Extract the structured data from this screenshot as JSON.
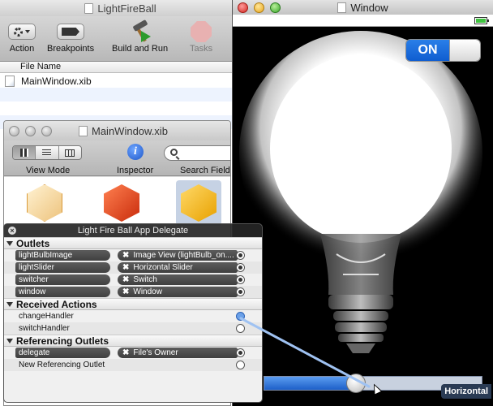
{
  "xcode": {
    "title": "LightFireBall",
    "toolbar": [
      {
        "label": "Action",
        "icon": "gear-icon"
      },
      {
        "label": "Breakpoints",
        "icon": "breakpoint-icon"
      },
      {
        "label": "Build and Run",
        "icon": "hammer-icon"
      },
      {
        "label": "Tasks",
        "icon": "stop-icon"
      }
    ],
    "file_column": "File Name",
    "files": [
      "MainWindow.xib"
    ]
  },
  "xib_window": {
    "title": "MainWindow.xib",
    "view_mode_label": "View Mode",
    "inspector_label": "Inspector",
    "search_label": "Search Field"
  },
  "hud": {
    "title": "Light Fire Ball App Delegate",
    "sections": {
      "outlets": "Outlets",
      "received_actions": "Received Actions",
      "referencing_outlets": "Referencing Outlets"
    },
    "outlets": [
      {
        "name": "lightBulbImage",
        "target": "Image View (lightBulb_on...."
      },
      {
        "name": "lightSlider",
        "target": "Horizontal Slider"
      },
      {
        "name": "switcher",
        "target": "Switch"
      },
      {
        "name": "window",
        "target": "Window"
      }
    ],
    "actions": [
      {
        "name": "changeHandler"
      },
      {
        "name": "switchHandler"
      }
    ],
    "referencing": [
      {
        "name": "delegate",
        "target": "File's Owner"
      },
      {
        "name": "New Referencing Outlet"
      }
    ]
  },
  "simulator": {
    "title": "Window",
    "switch_label": "ON",
    "slider_value": 0.42,
    "slider_label": "Horizontal"
  },
  "colors": {
    "accent_blue": "#1f5fd0",
    "hud_bg": "#262626",
    "battery_green": "#3fc33f"
  }
}
